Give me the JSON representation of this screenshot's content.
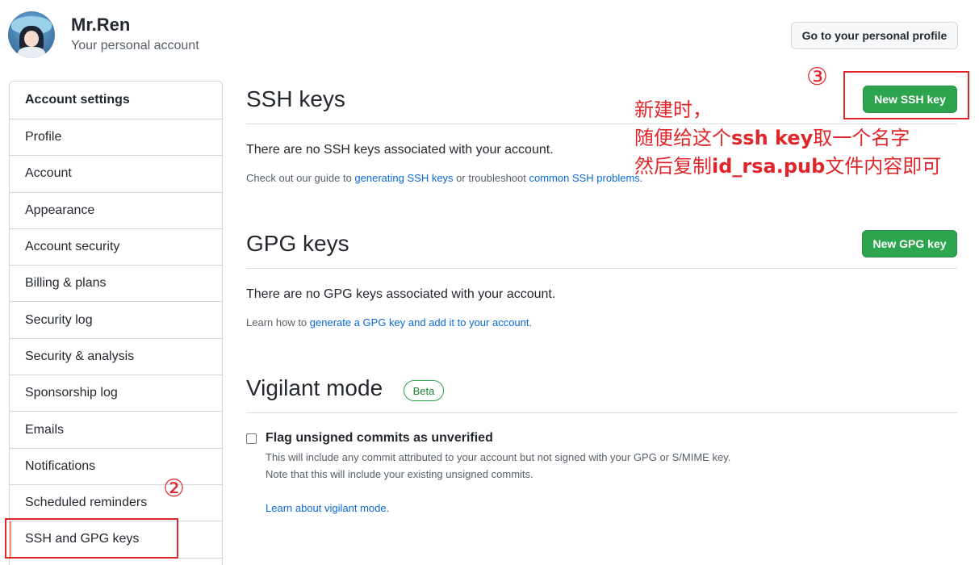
{
  "header": {
    "user_name": "Mr.Ren",
    "account_type": "Your personal account",
    "profile_button": "Go to your personal profile"
  },
  "sidebar": {
    "heading": "Account settings",
    "items": [
      {
        "label": "Profile"
      },
      {
        "label": "Account"
      },
      {
        "label": "Appearance"
      },
      {
        "label": "Account security"
      },
      {
        "label": "Billing & plans"
      },
      {
        "label": "Security log"
      },
      {
        "label": "Security & analysis"
      },
      {
        "label": "Sponsorship log"
      },
      {
        "label": "Emails"
      },
      {
        "label": "Notifications"
      },
      {
        "label": "Scheduled reminders"
      },
      {
        "label": "SSH and GPG keys",
        "selected": true
      }
    ]
  },
  "ssh": {
    "title": "SSH keys",
    "button": "New SSH key",
    "empty_text": "There are no SSH keys associated with your account.",
    "note_prefix": "Check out our guide to ",
    "note_link1": "generating SSH keys",
    "note_middle": " or troubleshoot ",
    "note_link2": "common SSH problems",
    "note_suffix": "."
  },
  "gpg": {
    "title": "GPG keys",
    "button": "New GPG key",
    "empty_text": "There are no GPG keys associated with your account.",
    "note_prefix": "Learn how to ",
    "note_link": "generate a GPG key and add it to your account",
    "note_suffix": "."
  },
  "vigilant": {
    "title": "Vigilant mode",
    "badge": "Beta",
    "checkbox_label": "Flag unsigned commits as unverified",
    "checked": false,
    "desc_line1": "This will include any commit attributed to your account but not signed with your GPG or S/MIME key.",
    "desc_line2": "Note that this will include your existing unsigned commits.",
    "learn_link": "Learn about vigilant mode."
  },
  "annotations": {
    "marker_2": "②",
    "marker_3": "③",
    "line1": "新建时，",
    "line2_a": "随便给这个",
    "line2_b": "ssh key",
    "line2_c": "取一个名字",
    "line3_a": "然后复制",
    "line3_b": "id_rsa.pub",
    "line3_c": "文件内容即可",
    "color": "#e0262b"
  },
  "colors": {
    "primary_button": "#2da44e",
    "link": "#0969da",
    "selected_indicator": "#fd8c73"
  }
}
